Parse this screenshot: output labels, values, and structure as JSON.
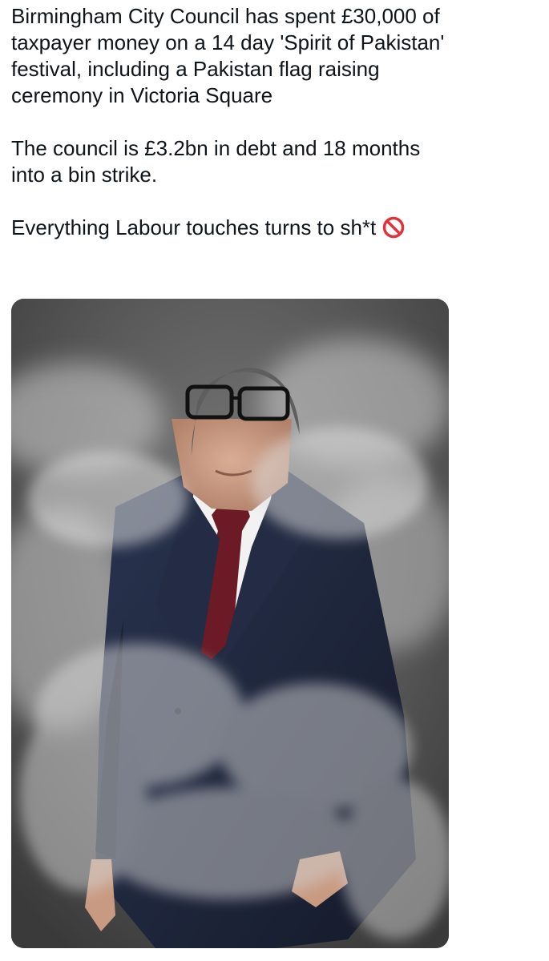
{
  "tweet": {
    "paragraphs": [
      {
        "lines": [
          "Birmingham City Council has spent £30,000 of",
          "taxpayer money on a 14 day 'Spirit of Pakistan'",
          "festival, including a Pakistan flag raising",
          "ceremony in Victoria Square"
        ]
      },
      {
        "lines": [
          "The council is £3.2bn in debt and 18 months",
          "into a bin strike."
        ]
      },
      {
        "lines": [
          "Everything Labour touches turns to sh*t"
        ],
        "trailing_emoji": "prohibited-icon"
      }
    ]
  },
  "media": {
    "description_icon": "photo",
    "colors": {
      "background": "#4a4a4a",
      "suit": "#1c2438",
      "tie": "#6b1a26",
      "shirt": "#f2f2f2",
      "skin": "#c99a82",
      "hair": "#5a5a5a",
      "smoke": "#d8d8d8"
    }
  }
}
